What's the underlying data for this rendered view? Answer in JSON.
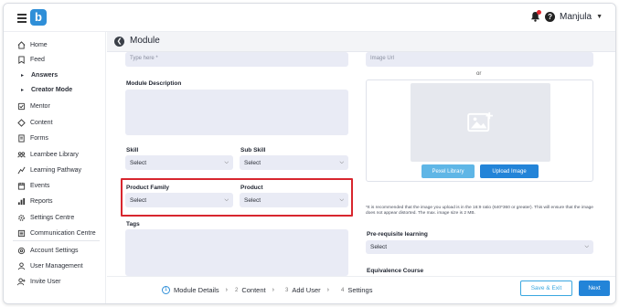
{
  "app": {
    "logo_letter": "b",
    "user_name": "Manjula"
  },
  "sidebar": {
    "items": [
      {
        "label": "Home",
        "icon": "home-icon"
      },
      {
        "label": "Feed",
        "icon": "feed-icon"
      },
      {
        "label": "Answers",
        "icon": "triangle-right-icon",
        "sub": true
      },
      {
        "label": "Creator Mode",
        "icon": "triangle-right-icon",
        "sub": true
      },
      {
        "label": "Mentor",
        "icon": "mentor-icon"
      },
      {
        "label": "Content",
        "icon": "content-icon"
      },
      {
        "label": "Forms",
        "icon": "forms-icon"
      },
      {
        "label": "Learnbee Library",
        "icon": "library-icon"
      },
      {
        "label": "Learning Pathway",
        "icon": "pathway-icon"
      },
      {
        "label": "Events",
        "icon": "events-icon"
      },
      {
        "label": "Reports",
        "icon": "reports-icon"
      },
      {
        "label": "Settings Centre",
        "icon": "settings-icon"
      },
      {
        "label": "Communication Centre",
        "icon": "communication-icon"
      },
      {
        "label": "Account Settings",
        "icon": "account-icon"
      },
      {
        "label": "User Management",
        "icon": "user-management-icon"
      },
      {
        "label": "Invite User",
        "icon": "invite-icon"
      }
    ]
  },
  "page": {
    "title": "Module"
  },
  "form": {
    "name_placeholder": "Type here *",
    "description_label": "Module Description",
    "skill_label": "Skill",
    "skill_value": "Select",
    "subskill_label": "Sub Skill",
    "subskill_value": "Select",
    "product_family_label": "Product Family",
    "product_family_value": "Select",
    "product_label": "Product",
    "product_value": "Select",
    "tags_label": "Tags",
    "image_url_placeholder": "Image Url",
    "or_text": "or",
    "pexel_button": "Pexel Library",
    "upload_button": "Upload Image",
    "image_note": "*It is recommended that the image you upload is in the 16:9 ratio (640*360 or greater). This will ensure that the image does not appear distorted. The max. image size is 2 MB.",
    "prereq_label": "Pre-requisite learning",
    "prereq_value": "Select",
    "equivalence_label": "Equivalence Course"
  },
  "footer": {
    "steps": [
      {
        "num": "1",
        "label": "Module Details",
        "active": true
      },
      {
        "num": "2",
        "label": "Content"
      },
      {
        "num": "3",
        "label": "Add User"
      },
      {
        "num": "4",
        "label": "Settings"
      }
    ],
    "save_exit": "Save & Exit",
    "next": "Next"
  },
  "colors": {
    "accent": "#2384d8",
    "highlight": "#d8262e",
    "input_bg": "#e9ebf5"
  }
}
